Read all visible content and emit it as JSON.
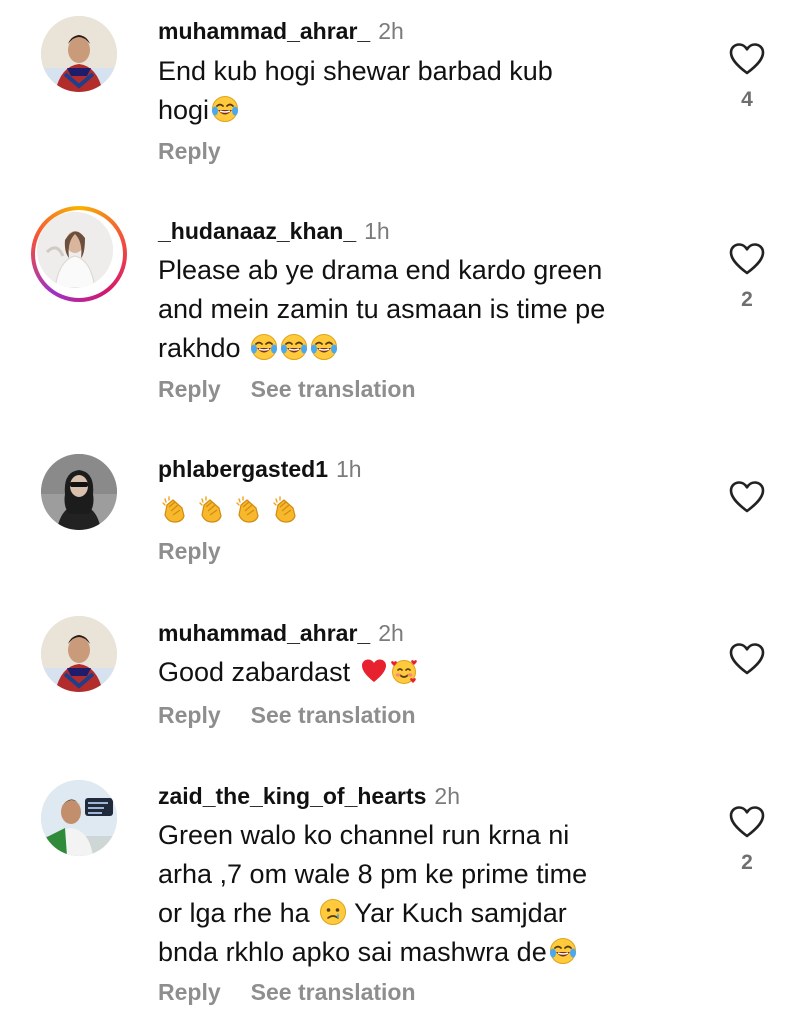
{
  "comments": [
    {
      "username": "muhammad_ahrar_",
      "time": "2h",
      "text_parts": [
        "End kub hogi shewar barbad kub",
        "hogi"
      ],
      "reply_label": "Reply",
      "likes": "4"
    },
    {
      "username": "_hudanaaz_khan_",
      "time": "1h",
      "text_parts": [
        "Please ab ye drama end kardo green",
        "and mein zamin tu asmaan is time pe",
        "rakhdo "
      ],
      "reply_label": "Reply",
      "translate_label": "See translation",
      "likes": "2"
    },
    {
      "username": "phlabergasted1",
      "time": "1h",
      "reply_label": "Reply"
    },
    {
      "username": "muhammad_ahrar_",
      "time": "2h",
      "text_parts": [
        "Good zabardast "
      ],
      "reply_label": "Reply",
      "translate_label": "See translation"
    },
    {
      "username": "zaid_the_king_of_hearts",
      "time": "2h",
      "text_parts": [
        "Green walo ko channel run krna ni",
        "arha ,7 om wale 8 pm ke prime time",
        "or lga rhe ha ",
        " Yar Kuch samjdar",
        "bnda rkhlo apko sai mashwra de"
      ],
      "reply_label": "Reply",
      "translate_label": "See translation",
      "likes": "2"
    }
  ],
  "colors": {
    "text": "#111111",
    "muted": "#8e8e8e",
    "time": "#7b7b7b"
  },
  "icons": {
    "like": "heart-outline-icon",
    "laugh": "face-with-tears-of-joy-emoji",
    "clap": "clapping-hands-emoji",
    "heart": "red-heart-emoji",
    "love": "smiling-face-with-hearts-emoji",
    "cry": "crying-face-emoji"
  }
}
